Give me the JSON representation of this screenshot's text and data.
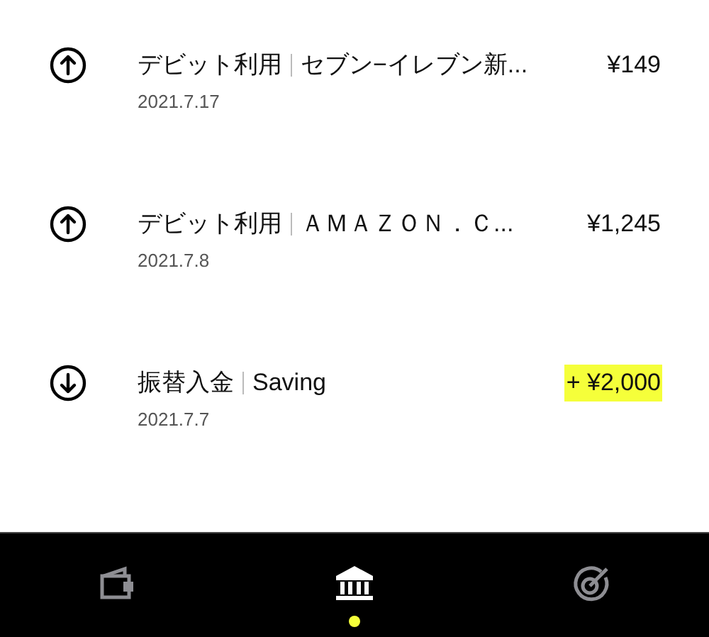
{
  "transactions": [
    {
      "kind": "out",
      "category": "デビット利用",
      "merchant": "セブン−イレブン新...",
      "amount": "¥149",
      "date": "2021.7.17"
    },
    {
      "kind": "out",
      "category": "デビット利用",
      "merchant": "ＡＭＡＺＯＮ．Ｃ...",
      "amount": "¥1,245",
      "date": "2021.7.8"
    },
    {
      "kind": "in",
      "category": "振替入金",
      "merchant": "Saving",
      "amount": "+ ¥2,000",
      "date": "2021.7.7"
    }
  ],
  "tab_bar": [
    {
      "kind": "wallet",
      "selected": false
    },
    {
      "kind": "bank",
      "selected": true
    },
    {
      "kind": "target",
      "selected": false
    }
  ]
}
